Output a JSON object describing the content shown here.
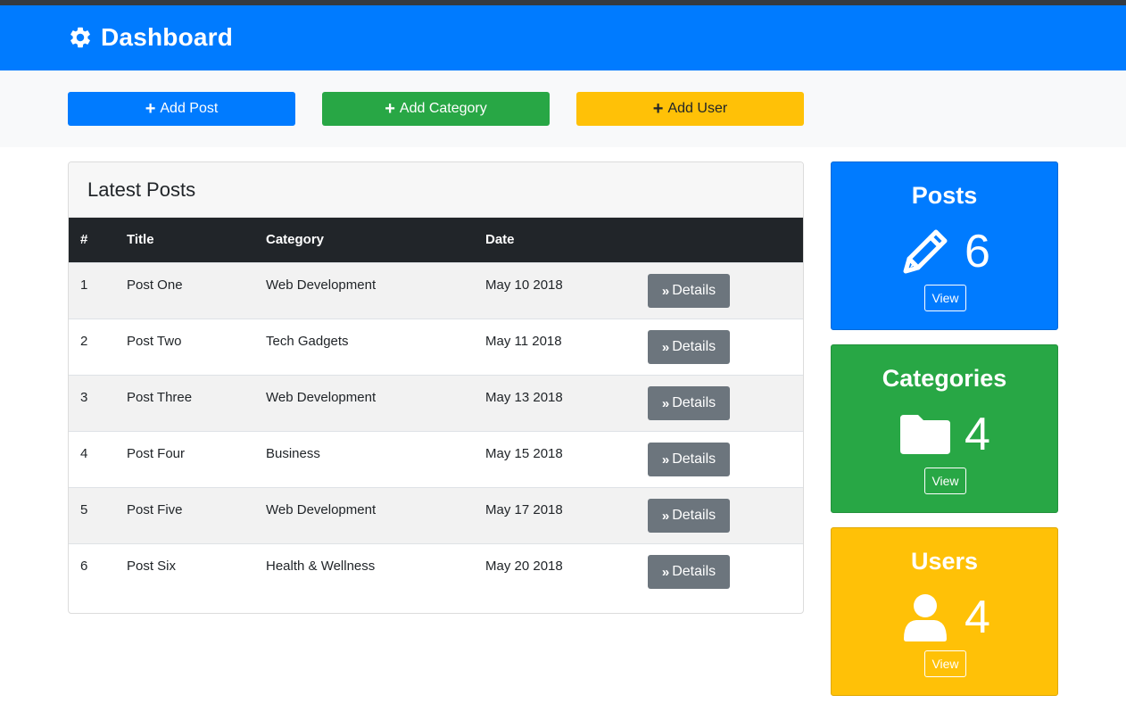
{
  "header": {
    "title": "Dashboard",
    "icon": "gear-icon",
    "background": "#007bff"
  },
  "actions": {
    "add_post": "Add Post",
    "add_category": "Add Category",
    "add_user": "Add User",
    "icon": "plus-icon"
  },
  "latest_posts": {
    "title": "Latest Posts",
    "columns": [
      "#",
      "Title",
      "Category",
      "Date"
    ],
    "rows": [
      {
        "num": "1",
        "title": "Post One",
        "category": "Web Development",
        "date": "May 10 2018",
        "button": "Details"
      },
      {
        "num": "2",
        "title": "Post Two",
        "category": "Tech Gadgets",
        "date": "May 11 2018",
        "button": "Details"
      },
      {
        "num": "3",
        "title": "Post Three",
        "category": "Web Development",
        "date": "May 13 2018",
        "button": "Details"
      },
      {
        "num": "4",
        "title": "Post Four",
        "category": "Business",
        "date": "May 15 2018",
        "button": "Details"
      },
      {
        "num": "5",
        "title": "Post Five",
        "category": "Web Development",
        "date": "May 17 2018",
        "button": "Details"
      },
      {
        "num": "6",
        "title": "Post Six",
        "category": "Health & Wellness",
        "date": "May 20 2018",
        "button": "Details"
      }
    ]
  },
  "stats": {
    "posts": {
      "title": "Posts",
      "count": "6",
      "view": "View",
      "icon": "pencil-icon",
      "color": "#007bff"
    },
    "categories": {
      "title": "Categories",
      "count": "4",
      "view": "View",
      "icon": "folder-icon",
      "color": "#28a745"
    },
    "users": {
      "title": "Users",
      "count": "4",
      "view": "View",
      "icon": "user-icon",
      "color": "#ffc107"
    }
  }
}
